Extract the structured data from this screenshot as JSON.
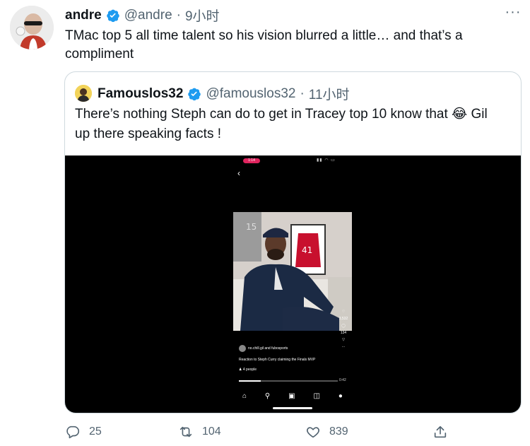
{
  "tweet": {
    "author_name": "andre",
    "handle": "@andre",
    "separator": "·",
    "time": "9小时",
    "text": "TMac top 5 all time talent so his vision blurred a little… and that’s a compliment",
    "more_label": "···"
  },
  "quoted": {
    "author_name": "Famouslos32",
    "handle": "@famouslos32",
    "separator": "·",
    "time": "11小时",
    "text": "There’s nothing Steph can do to get in Tracey top 10 know that 😂 Gil up there speaking facts !"
  },
  "video": {
    "status_time": "1:14",
    "poster_user": "no.chill.gil and fubosports",
    "caption": "Reaction to Steph Curry claiming the Finals MVP",
    "people": "4 people",
    "likes": "3,532",
    "comments": "134",
    "duration": "0:42",
    "progress": 0.22,
    "jersey_numbers": [
      "15",
      "41"
    ]
  },
  "actions": {
    "reply_count": "25",
    "retweet_count": "104",
    "like_count": "839"
  },
  "colors": {
    "verified": "#1d9bf0",
    "muted_text": "#536471",
    "border": "#cfd9de"
  }
}
